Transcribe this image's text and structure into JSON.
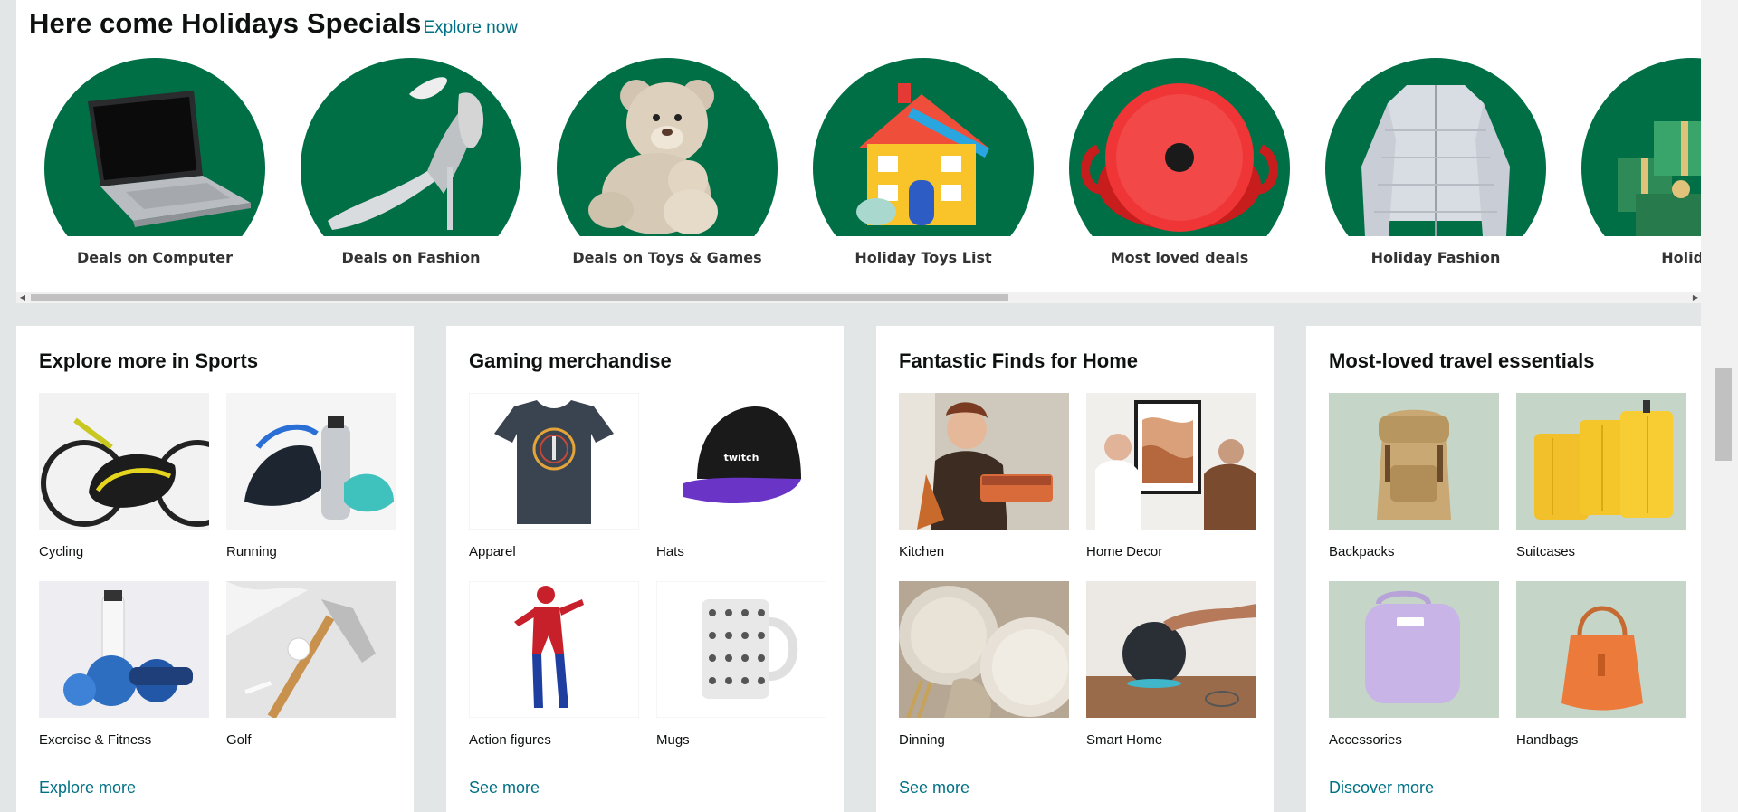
{
  "holidays": {
    "title": "Here come Holidays Specials",
    "explore_label": "Explore now",
    "items": [
      {
        "label": "Deals on Computer",
        "icon": "laptop-icon"
      },
      {
        "label": "Deals on Fashion",
        "icon": "high-heel-icon"
      },
      {
        "label": "Deals on Toys & Games",
        "icon": "teddy-bear-icon"
      },
      {
        "label": "Holiday Toys List",
        "icon": "toy-house-icon"
      },
      {
        "label": "Most loved deals",
        "icon": "dutch-oven-icon"
      },
      {
        "label": "Holiday Fashion",
        "icon": "puffer-jacket-icon"
      },
      {
        "label": "Holiday",
        "icon": "gift-boxes-icon"
      }
    ]
  },
  "cards": [
    {
      "title": "Explore more in Sports",
      "link": "Explore more",
      "tiles": [
        {
          "label": "Cycling",
          "icon": "cycling-helmet-icon"
        },
        {
          "label": "Running",
          "icon": "running-shoes-icon"
        },
        {
          "label": "Exercise & Fitness",
          "icon": "fitness-gear-icon"
        },
        {
          "label": "Golf",
          "icon": "golf-club-icon"
        }
      ]
    },
    {
      "title": "Gaming merchandise",
      "link": "See more",
      "tiles": [
        {
          "label": "Apparel",
          "icon": "tshirt-icon"
        },
        {
          "label": "Hats",
          "icon": "cap-icon"
        },
        {
          "label": "Action figures",
          "icon": "action-figure-icon"
        },
        {
          "label": "Mugs",
          "icon": "mug-icon"
        }
      ]
    },
    {
      "title": "Fantastic Finds for Home",
      "link": "See more",
      "tiles": [
        {
          "label": "Kitchen",
          "icon": "kitchen-icon"
        },
        {
          "label": "Home Decor",
          "icon": "wall-art-icon"
        },
        {
          "label": "Dinning",
          "icon": "plates-icon"
        },
        {
          "label": "Smart Home",
          "icon": "smart-speaker-icon"
        }
      ]
    },
    {
      "title": "Most-loved travel essentials",
      "link": "Discover more",
      "tiles": [
        {
          "label": "Backpacks",
          "icon": "backpack-icon"
        },
        {
          "label": "Suitcases",
          "icon": "suitcase-icon"
        },
        {
          "label": "Accessories",
          "icon": "lunch-bag-icon"
        },
        {
          "label": "Handbags",
          "icon": "handbag-icon"
        }
      ]
    }
  ],
  "colors": {
    "link": "#007185",
    "holiday_green": "#006f46",
    "page_bg": "#e3e6e6"
  }
}
